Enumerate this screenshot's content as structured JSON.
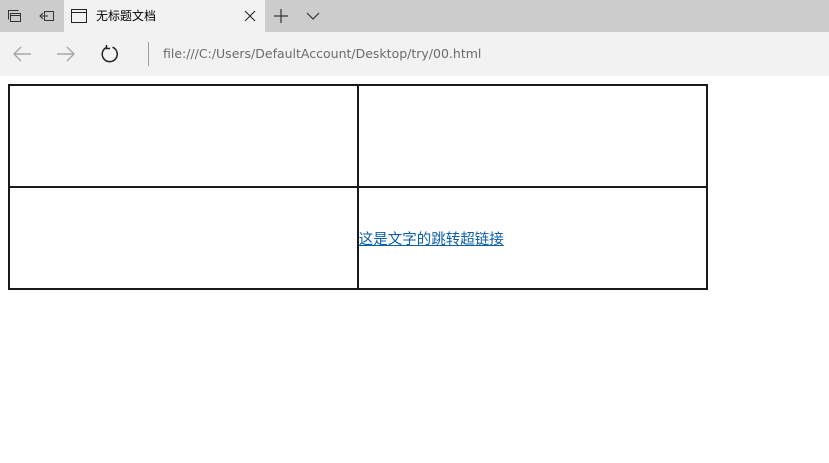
{
  "browser": {
    "tab": {
      "title": "无标题文档"
    },
    "address_bar": {
      "url": "file:///C:/Users/DefaultAccount/Desktop/try/00.html"
    }
  },
  "page": {
    "table": {
      "rows": [
        [
          "",
          ""
        ],
        [
          "",
          "这是文字的跳转超链接"
        ]
      ]
    }
  },
  "colors": {
    "titlebar_bg": "#cccccc",
    "toolbar_bg": "#f2f2f2",
    "link": "#0b5ea8",
    "table_border": "#1a1a1a"
  }
}
